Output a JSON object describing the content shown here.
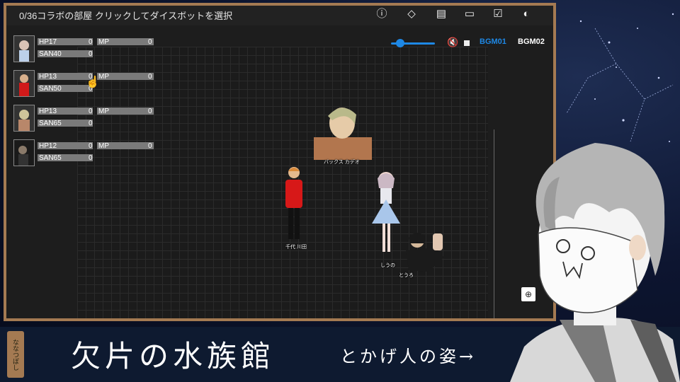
{
  "room": {
    "title": "0/36コラボの部屋 クリックしてダイスボットを選択"
  },
  "toolbar": {
    "icons": [
      "info-icon",
      "dice-icon",
      "chat-icon",
      "screen-icon",
      "check-icon",
      "user-icon"
    ]
  },
  "audio": {
    "bgm1": "BGM01",
    "bgm2": "BGM02",
    "mute_icon": "mute-icon",
    "accent": "#1e88e5",
    "bgm2_color": "#ffffff"
  },
  "characters": [
    {
      "hp_label": "HP17",
      "hp_val": "0",
      "mp_label": "MP",
      "mp_val": "0",
      "san_label": "SAN40",
      "san_val": "0"
    },
    {
      "hp_label": "HP13",
      "hp_val": "0",
      "mp_label": "MP",
      "mp_val": "0",
      "san_label": "SAN50",
      "san_val": "0"
    },
    {
      "hp_label": "HP13",
      "hp_val": "0",
      "mp_label": "MP",
      "mp_val": "0",
      "san_label": "SAN65",
      "san_val": "0"
    },
    {
      "hp_label": "HP12",
      "hp_val": "0",
      "mp_label": "MP",
      "mp_val": "0",
      "san_label": "SAN65",
      "san_val": "0"
    }
  ],
  "tokens": [
    {
      "name": "バックス カデオ"
    },
    {
      "name": "千代 川田"
    },
    {
      "name": "しうの"
    },
    {
      "name": "とうろ"
    }
  ],
  "banner": {
    "title": "欠片の水族館",
    "subtitle": "とかげ人の姿→",
    "side_label": "ななつぼし"
  },
  "colors": {
    "frame": "#a47a52",
    "board": "#1b1b1b"
  }
}
